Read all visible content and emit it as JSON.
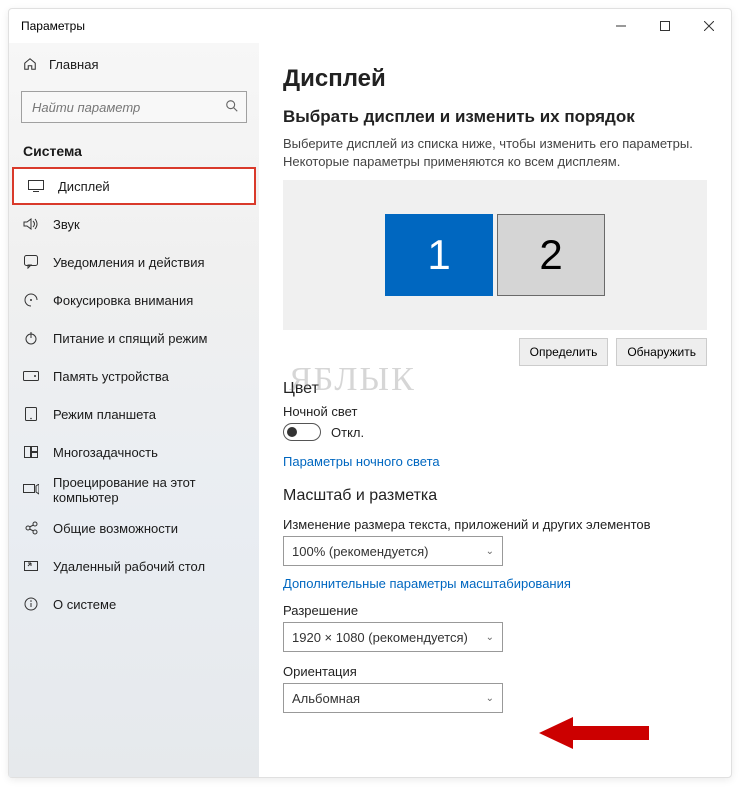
{
  "window": {
    "title": "Параметры"
  },
  "sidebar": {
    "home_label": "Главная",
    "search_placeholder": "Найти параметр",
    "section": "Система",
    "items": [
      {
        "label": "Дисплей",
        "active": true
      },
      {
        "label": "Звук"
      },
      {
        "label": "Уведомления и действия"
      },
      {
        "label": "Фокусировка внимания"
      },
      {
        "label": "Питание и спящий режим"
      },
      {
        "label": "Память устройства"
      },
      {
        "label": "Режим планшета"
      },
      {
        "label": "Многозадачность"
      },
      {
        "label": "Проецирование на этот компьютер"
      },
      {
        "label": "Общие возможности"
      },
      {
        "label": "Удаленный рабочий стол"
      },
      {
        "label": "О системе"
      }
    ]
  },
  "main": {
    "heading": "Дисплей",
    "arrange": {
      "title": "Выбрать дисплеи и изменить их порядок",
      "desc": "Выберите дисплей из списка ниже, чтобы изменить его параметры. Некоторые параметры применяются ко всем дисплеям.",
      "displays": [
        {
          "id": "1",
          "selected": true
        },
        {
          "id": "2",
          "selected": false
        }
      ],
      "identify_label": "Определить",
      "detect_label": "Обнаружить"
    },
    "color": {
      "title": "Цвет",
      "nightlight_label": "Ночной свет",
      "nightlight_state": "Откл.",
      "nightlight_link": "Параметры ночного света"
    },
    "scale": {
      "title": "Масштаб и разметка",
      "scale_label": "Изменение размера текста, приложений и других элементов",
      "scale_value": "100% (рекомендуется)",
      "advanced_link": "Дополнительные параметры масштабирования",
      "resolution_label": "Разрешение",
      "resolution_value": "1920 × 1080 (рекомендуется)",
      "orientation_label": "Ориентация",
      "orientation_value": "Альбомная"
    }
  },
  "watermark": "ЯБЛЫК",
  "colors": {
    "accent": "#0067c0",
    "highlight": "#d93a2b",
    "arrow": "#cc0000"
  }
}
